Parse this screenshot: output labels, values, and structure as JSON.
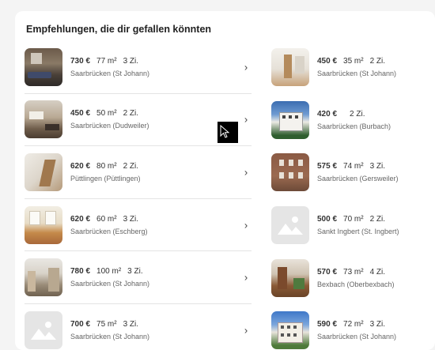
{
  "section": {
    "title": "Empfehlungen, die dir gefallen könnten"
  },
  "left_listings": [
    {
      "price": "730 €",
      "area": "77 m²",
      "rooms": "3 Zi.",
      "location": "Saarbrücken (St Johann)"
    },
    {
      "price": "450 €",
      "area": "50 m²",
      "rooms": "2 Zi.",
      "location": "Saarbrücken (Dudweiler)"
    },
    {
      "price": "620 €",
      "area": "80 m²",
      "rooms": "2 Zi.",
      "location": "Püttlingen (Püttlingen)"
    },
    {
      "price": "620 €",
      "area": "60 m²",
      "rooms": "3 Zi.",
      "location": "Saarbrücken (Eschberg)"
    },
    {
      "price": "780 €",
      "area": "100 m²",
      "rooms": "3 Zi.",
      "location": "Saarbrücken (St Johann)"
    },
    {
      "price": "700 €",
      "area": "75 m²",
      "rooms": "3 Zi.",
      "location": "Saarbrücken (St Johann)"
    }
  ],
  "right_listings": [
    {
      "price": "450 €",
      "area": "35 m²",
      "rooms": "2 Zi.",
      "location": "Saarbrücken (St Johann)"
    },
    {
      "price": "420 €",
      "area": "",
      "rooms": "2 Zi.",
      "location": "Saarbrücken (Burbach)"
    },
    {
      "price": "575 €",
      "area": "74 m²",
      "rooms": "3 Zi.",
      "location": "Saarbrücken (Gersweiler)"
    },
    {
      "price": "500 €",
      "area": "70 m²",
      "rooms": "2 Zi.",
      "location": "Sankt Ingbert (St. Ingbert)"
    },
    {
      "price": "570 €",
      "area": "73 m²",
      "rooms": "4 Zi.",
      "location": "Bexbach (Oberbexbach)"
    },
    {
      "price": "590 €",
      "area": "72 m²",
      "rooms": "3 Zi.",
      "location": "Saarbrücken (St Johann)"
    }
  ],
  "icons": {
    "row_arrow": "chevron-right-icon",
    "no_image": "image-placeholder-icon"
  },
  "colors": {
    "background": "#f4f4f4",
    "card": "#ffffff",
    "divider": "#e4e4e4"
  }
}
